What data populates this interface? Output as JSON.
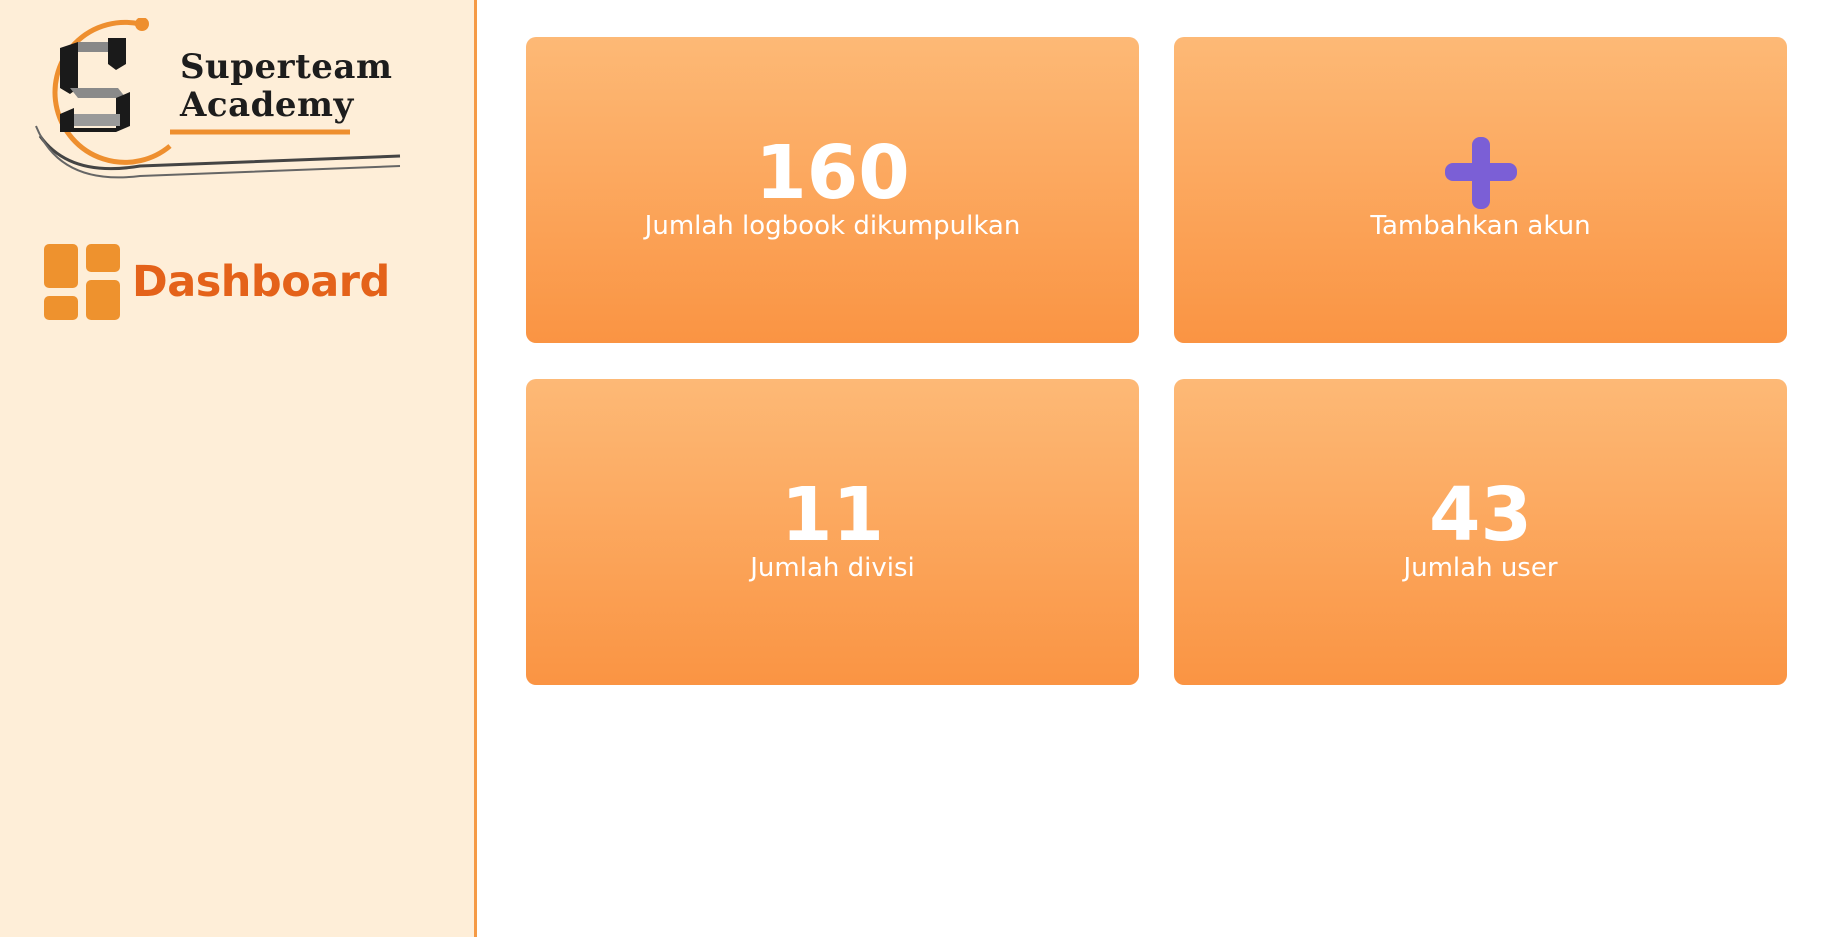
{
  "brand": {
    "line1": "Superteam",
    "line2": "Academy"
  },
  "sidebar": {
    "items": [
      {
        "label": "Dashboard",
        "icon": "dashboard-grid-icon"
      }
    ]
  },
  "cards": [
    {
      "value": "160",
      "label": "Jumlah logbook dikumpulkan"
    },
    {
      "icon": "plus-icon",
      "label": "Tambahkan akun"
    },
    {
      "value": "11",
      "label": "Jumlah divisi"
    },
    {
      "value": "43",
      "label": "Jumlah user"
    }
  ],
  "colors": {
    "sidebar_bg": "#feeed8",
    "accent": "#e4621a",
    "card_top": "#fdb976",
    "card_bottom": "#fa9443",
    "plus": "#7b5fd6"
  }
}
